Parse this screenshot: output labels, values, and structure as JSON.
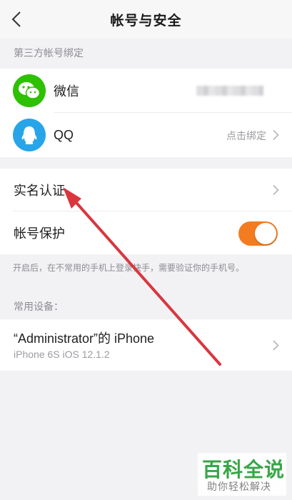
{
  "nav": {
    "title": "帐号与安全"
  },
  "third_party": {
    "section_label": "第三方帐号绑定",
    "items": [
      {
        "label": "微信",
        "icon": "wechat-icon"
      },
      {
        "label": "QQ",
        "icon": "qq-icon",
        "action": "点击绑定"
      }
    ]
  },
  "security": {
    "items": [
      {
        "label": "实名认证"
      },
      {
        "label": "帐号保护",
        "toggle_on": true
      }
    ],
    "hint": "开启后，在不常用的手机上登录快手，需要验证你的手机号。"
  },
  "devices": {
    "section_label": "常用设备：",
    "items": [
      {
        "name": "“Administrator”的 iPhone",
        "detail": "iPhone 6S iOS 12.1.2"
      }
    ]
  },
  "watermark": {
    "title": "百科全说",
    "subtitle": "助你轻松解决"
  },
  "colors": {
    "wechat": "#2dc100",
    "qq": "#28a5e8",
    "toggle_on": "#f37c21",
    "annotation_arrow": "#d9363e"
  }
}
